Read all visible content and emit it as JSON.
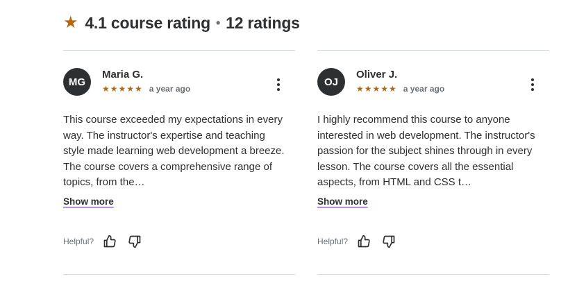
{
  "header": {
    "rating": "4.1 course rating",
    "separator": "•",
    "count": "12 ratings"
  },
  "reviews": [
    {
      "initials": "MG",
      "name": "Maria G.",
      "stars": "★★★★★",
      "time": "a year ago",
      "text": "This course exceeded my expectations in every way. The instructor's expertise and teaching style made learning web development a breeze. The course covers a comprehensive range of topics, from the…",
      "show_more": "Show more",
      "helpful_label": "Helpful?"
    },
    {
      "initials": "OJ",
      "name": "Oliver J.",
      "stars": "★★★★★",
      "time": "a year ago",
      "text": "I highly recommend this course to anyone interested in web development. The instructor's passion for the subject shines through in every lesson. The course covers all the essential aspects, from HTML and CSS t…",
      "show_more": "Show more",
      "helpful_label": "Helpful?"
    }
  ],
  "colors": {
    "accent_star": "#b4690e",
    "text": "#2d2f31",
    "muted": "#6a6f73",
    "divider": "#d1d7dc"
  }
}
